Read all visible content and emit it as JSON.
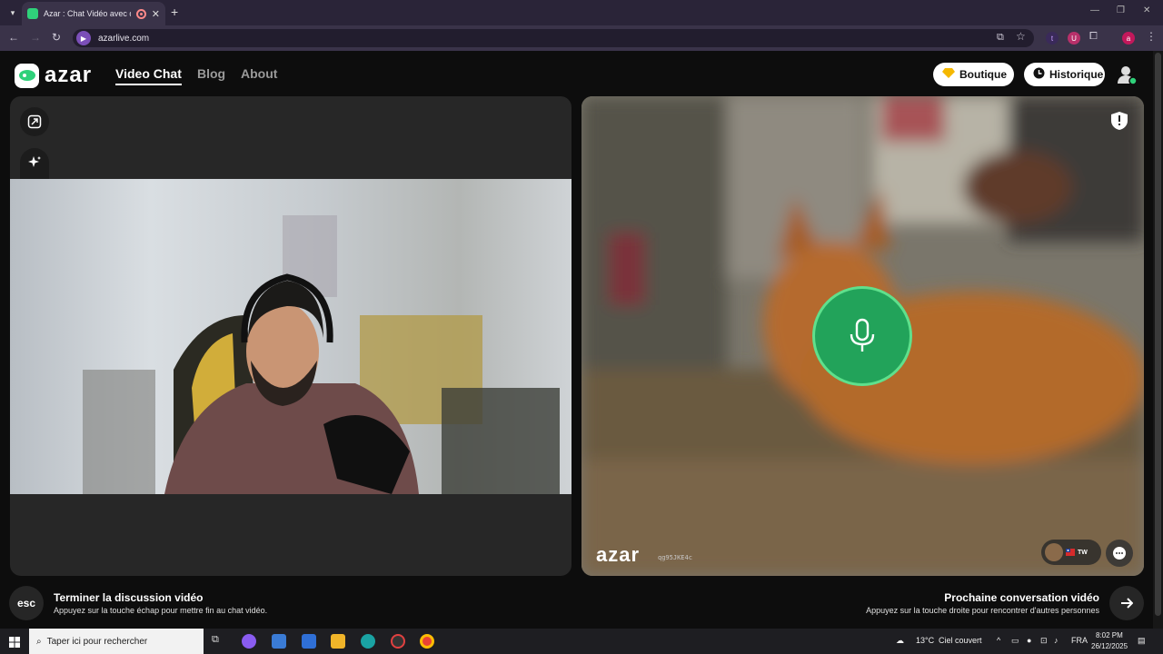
{
  "browser": {
    "tab_title": "Azar : Chat Vidéo avec de n",
    "url": "azarlive.com",
    "ext_t": "t",
    "ext_u": "U",
    "profile": "a"
  },
  "site": {
    "logo_text": "azar",
    "nav": [
      "Video Chat",
      "Blog",
      "About"
    ],
    "shop_label": "Boutique",
    "history_label": "Historique"
  },
  "remote": {
    "watermark": "azar",
    "session_id": "qg95JKE4c",
    "peer_country": "TW"
  },
  "hints": {
    "esc_key": "esc",
    "end_title": "Terminer la discussion vidéo",
    "end_sub": "Appuyez sur la touche échap pour mettre fin au chat vidéo.",
    "next_title": "Prochaine conversation vidéo",
    "next_sub": "Appuyez sur la touche droite pour rencontrer d'autres personnes"
  },
  "taskbar": {
    "search_placeholder": "Taper ici pour rechercher",
    "temperature": "13°C",
    "weather": "Ciel couvert",
    "lang": "FRA",
    "time": "8:02 PM",
    "date": "26/12/2025"
  },
  "colors": {
    "accent_green": "#22a35a",
    "tab_bg": "#3a3349"
  }
}
